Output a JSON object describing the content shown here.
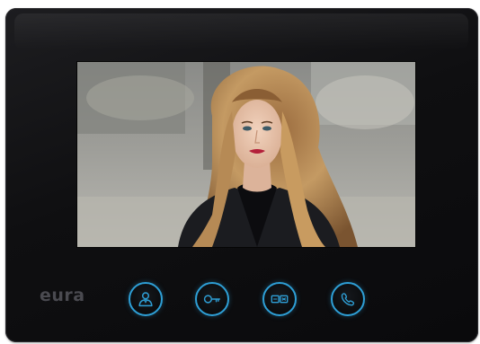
{
  "device": {
    "brand": "eura"
  },
  "screen": {
    "content": "video-feed"
  },
  "buttons": [
    {
      "icon": "person-icon"
    },
    {
      "icon": "key-icon"
    },
    {
      "icon": "intercom-icon"
    },
    {
      "icon": "phone-icon"
    }
  ],
  "colors": {
    "accent": "#2e9fd6",
    "body": "#111113",
    "logo": "#4a4a50"
  }
}
